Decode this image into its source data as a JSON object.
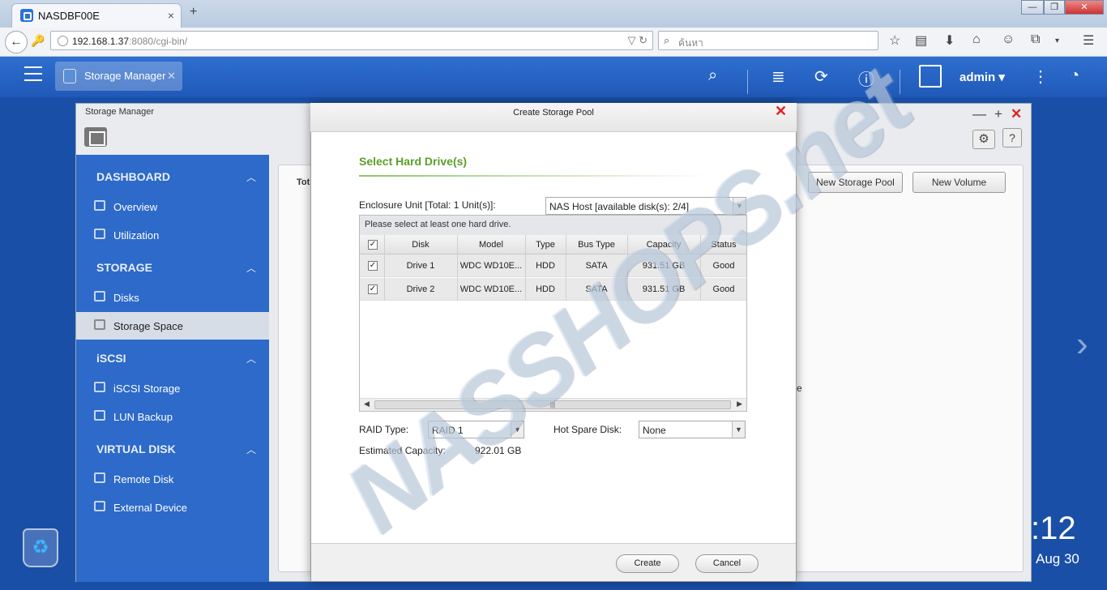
{
  "browser": {
    "tab_title": "NASDBF00E",
    "tab_close": "×",
    "new_tab": "+",
    "url_host": "192.168.1.37",
    "url_rest": ":8080/cgi-bin/",
    "search_placeholder": "ค้นหา",
    "window_controls": [
      "—",
      "❐",
      "✕"
    ]
  },
  "qts": {
    "app_tab_label": "Storage Manager",
    "user": "admin ▾",
    "clock": ":12",
    "date": "Aug 30"
  },
  "storage_manager": {
    "title": "Storage Manager",
    "sidebar": [
      {
        "section": "DASHBOARD",
        "items": [
          "Overview",
          "Utilization"
        ]
      },
      {
        "section": "STORAGE",
        "items": [
          "Disks",
          "Storage Space"
        ]
      },
      {
        "section": "iSCSI",
        "items": [
          "iSCSI Storage",
          "LUN Backup"
        ]
      },
      {
        "section": "VIRTUAL DISK",
        "items": [
          "Remote Disk",
          "External Device"
        ]
      }
    ],
    "active_item": "Storage Space",
    "total_label": "Tot",
    "new_pool_btn": "New Storage Pool",
    "new_volume_btn": "New Volume",
    "partial_text": "e"
  },
  "dialog": {
    "title": "Create Storage Pool",
    "heading": "Select Hard Drive(s)",
    "enclosure_label": "Enclosure Unit [Total: 1 Unit(s)]:",
    "enclosure_value": "NAS Host [available disk(s): 2/4]",
    "note": "Please select at least one hard drive.",
    "columns": [
      "Disk",
      "Model",
      "Type",
      "Bus Type",
      "Capacity",
      "Status"
    ],
    "rows": [
      {
        "disk": "Drive 1",
        "model": "WDC WD10E...",
        "type": "HDD",
        "bus": "SATA",
        "capacity": "931.51 GB",
        "status": "Good",
        "checked": "✓"
      },
      {
        "disk": "Drive 2",
        "model": "WDC WD10E...",
        "type": "HDD",
        "bus": "SATA",
        "capacity": "931.51 GB",
        "status": "Good",
        "checked": "✓"
      }
    ],
    "header_check": "✓",
    "raid_label": "RAID Type:",
    "raid_value": "RAID 1",
    "hot_spare_label": "Hot Spare Disk:",
    "hot_spare_value": "None",
    "est_label": "Estimated Capacity:",
    "est_value": "922.01 GB",
    "create_btn": "Create",
    "cancel_btn": "Cancel"
  },
  "watermark": "NASSHOPS.net"
}
